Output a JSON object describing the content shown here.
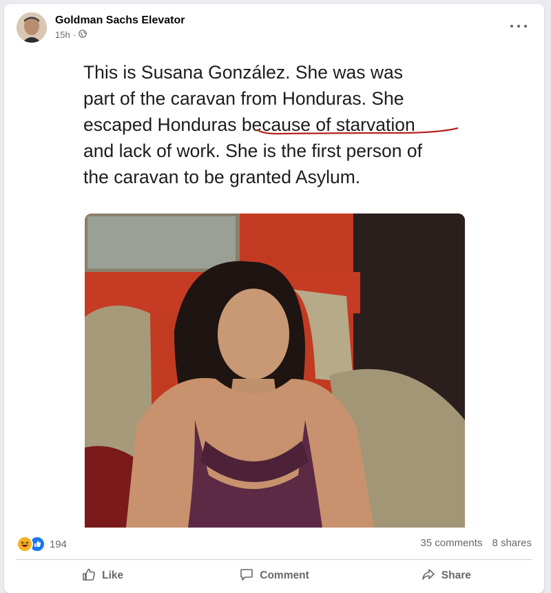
{
  "post": {
    "author": "Goldman Sachs Elevator",
    "time": "15h",
    "separator": "·",
    "text": "This is Susana González. She was was\npart of the caravan from Honduras. She\nescaped Honduras because of starvation\nand lack of work. She is the first person of\nthe caravan to be granted Asylum."
  },
  "stats": {
    "reaction_count": "194",
    "comments": "35 comments",
    "shares": "8 shares"
  },
  "actions": {
    "like": "Like",
    "comment": "Comment",
    "share": "Share"
  },
  "colors": {
    "meta": "#65676b",
    "like_blue": "#1877f2",
    "haha_yellow": "#f7b125",
    "underline": "#b5221d"
  }
}
